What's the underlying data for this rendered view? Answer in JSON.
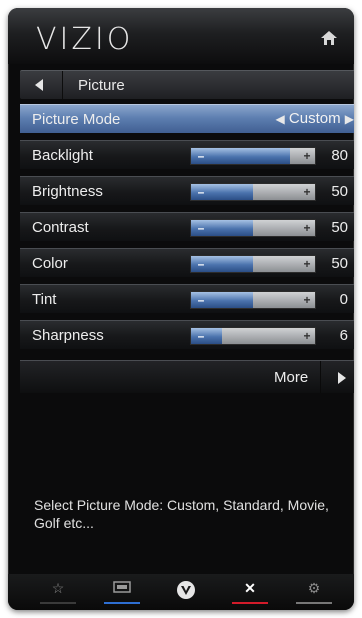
{
  "header": {
    "logo": "VIZIO",
    "home_icon": "home-icon"
  },
  "nav": {
    "back_label": "Picture"
  },
  "menu": {
    "picture_mode": {
      "label": "Picture Mode",
      "value": "Custom"
    },
    "items": [
      {
        "label": "Backlight",
        "value": "80",
        "level": 80
      },
      {
        "label": "Brightness",
        "value": "50",
        "level": 50
      },
      {
        "label": "Contrast",
        "value": "50",
        "level": 50
      },
      {
        "label": "Color",
        "value": "50",
        "level": 50
      },
      {
        "label": "Tint",
        "value": "0",
        "level": 50
      },
      {
        "label": "Sharpness",
        "value": "6",
        "level": 25
      }
    ],
    "more_label": "More"
  },
  "help_text": "Select Picture Mode: Custom, Standard, Movie, Golf etc...",
  "footer": {
    "buttons": [
      "star-icon",
      "widgets-icon",
      "vizio-v-icon",
      "close-icon",
      "settings-icon"
    ]
  },
  "colors": {
    "accent_blue": "#2e6fd3",
    "accent_red": "#d21b2a",
    "selected_row": "#5e7fb1"
  }
}
